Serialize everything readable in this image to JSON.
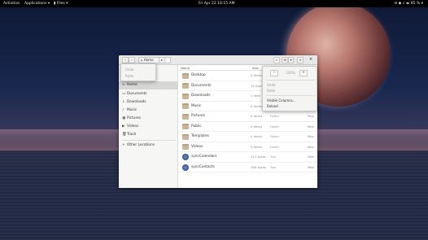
{
  "topbar": {
    "activities": "Activities",
    "applications": "Applications ▾",
    "files": "▮ Files ▾",
    "clock": "Fri Apr 22  10:15 AM",
    "system": "✉  ◆  ♪  ◂▸  85 % ▾"
  },
  "window": {
    "path_label": "⌂ Home",
    "path_more": "▸",
    "close": "✕"
  },
  "sidebar": {
    "items": [
      {
        "icon": "⌂",
        "label": "Home"
      },
      {
        "icon": "▭",
        "label": "Documents"
      },
      {
        "icon": "↓",
        "label": "Downloads"
      },
      {
        "icon": "♪",
        "label": "Music"
      },
      {
        "icon": "▣",
        "label": "Pictures"
      },
      {
        "icon": "▶",
        "label": "Videos"
      },
      {
        "icon": "🗑",
        "label": "Trash"
      },
      {
        "icon": "+",
        "label": "Other Locations"
      }
    ]
  },
  "list": {
    "headers": {
      "name": "Name",
      "size": "Size",
      "modified": "Modified"
    },
    "rows": [
      {
        "kind": "folder",
        "name": "Desktop",
        "size": "0 items",
        "type": "Folder",
        "modified": "Mon"
      },
      {
        "kind": "folder",
        "name": "Documents",
        "size": "14 items",
        "type": "Folder",
        "modified": "Mon"
      },
      {
        "kind": "folder",
        "name": "Downloads",
        "size": "1 item",
        "type": "Folder",
        "modified": "Mon"
      },
      {
        "kind": "folder",
        "name": "Music",
        "size": "0 items",
        "type": "Folder",
        "modified": "Mon"
      },
      {
        "kind": "folder",
        "name": "Pictures",
        "size": "0 items",
        "type": "Folder",
        "modified": "Mon"
      },
      {
        "kind": "folder",
        "name": "Public",
        "size": "0 items",
        "type": "Folder",
        "modified": "Mon"
      },
      {
        "kind": "folder",
        "name": "Templates",
        "size": "0 items",
        "type": "Folder",
        "modified": "Mon"
      },
      {
        "kind": "folder",
        "name": "Videos",
        "size": "0 items",
        "type": "Folder",
        "modified": "Mon"
      },
      {
        "kind": "file",
        "name": "syncCalendars",
        "size": "213 bytes",
        "type": "Text",
        "modified": "Wed"
      },
      {
        "kind": "file",
        "name": "syncContacts",
        "size": "269 bytes",
        "type": "Text",
        "modified": "Wed"
      }
    ]
  },
  "popover_left": {
    "undo": "Undo",
    "redo": "Redo"
  },
  "popover_right": {
    "zoom_out": "−",
    "zoom_level": "100%",
    "zoom_in": "+",
    "undo": "Undo",
    "redo": "Redo",
    "visible_columns": "Visible Columns...",
    "reload": "Reload"
  }
}
